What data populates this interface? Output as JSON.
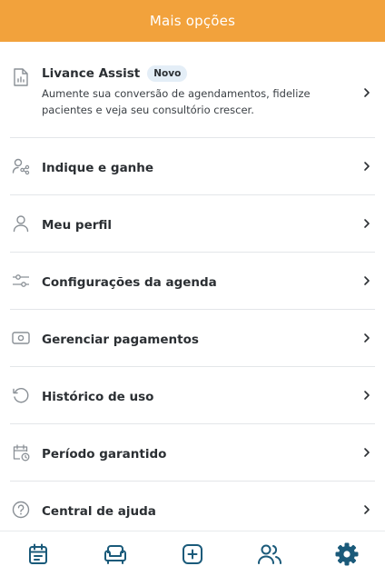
{
  "header": {
    "title": "Mais opções"
  },
  "menu": {
    "items": [
      {
        "label": "Livance Assist",
        "badge": "Novo",
        "description": "Aumente sua conversão de agendamentos, fidelize pacientes e veja seu consultório crescer.",
        "icon": "report-icon"
      },
      {
        "label": "Indique e ganhe",
        "icon": "share-users-icon"
      },
      {
        "label": "Meu perfil",
        "icon": "user-icon"
      },
      {
        "label": "Configurações da agenda",
        "icon": "sliders-icon"
      },
      {
        "label": "Gerenciar pagamentos",
        "icon": "banknote-icon"
      },
      {
        "label": "Histórico de uso",
        "icon": "history-icon"
      },
      {
        "label": "Período garantido",
        "icon": "calendar-clock-icon"
      },
      {
        "label": "Central de ajuda",
        "icon": "help-icon"
      }
    ]
  },
  "bottom_nav": {
    "items": [
      {
        "icon": "calendar-icon"
      },
      {
        "icon": "armchair-icon"
      },
      {
        "icon": "plus-square-icon"
      },
      {
        "icon": "users-icon"
      },
      {
        "icon": "settings-gear-icon",
        "active": true
      }
    ]
  },
  "colors": {
    "accent": "#f2a23c",
    "nav_icon": "#1a5a7a",
    "icon_gray": "#8a9096"
  }
}
